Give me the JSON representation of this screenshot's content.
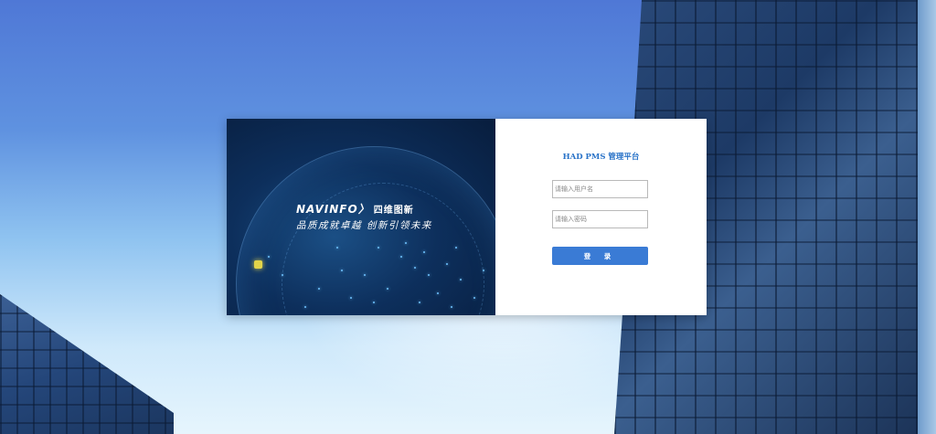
{
  "brand": {
    "logo_text": "NAVINFO〉",
    "logo_cn": "四维图新",
    "slogan": "品质成就卓越 创新引领未来"
  },
  "login": {
    "title": "HAD PMS  管理平台",
    "username_placeholder": "请输入用户名",
    "password_placeholder": "请输入密码",
    "submit_label": "登 录"
  },
  "colors": {
    "accent": "#3a7bd5",
    "title": "#2a73c8",
    "brand_panel": "#0d2f5c"
  }
}
